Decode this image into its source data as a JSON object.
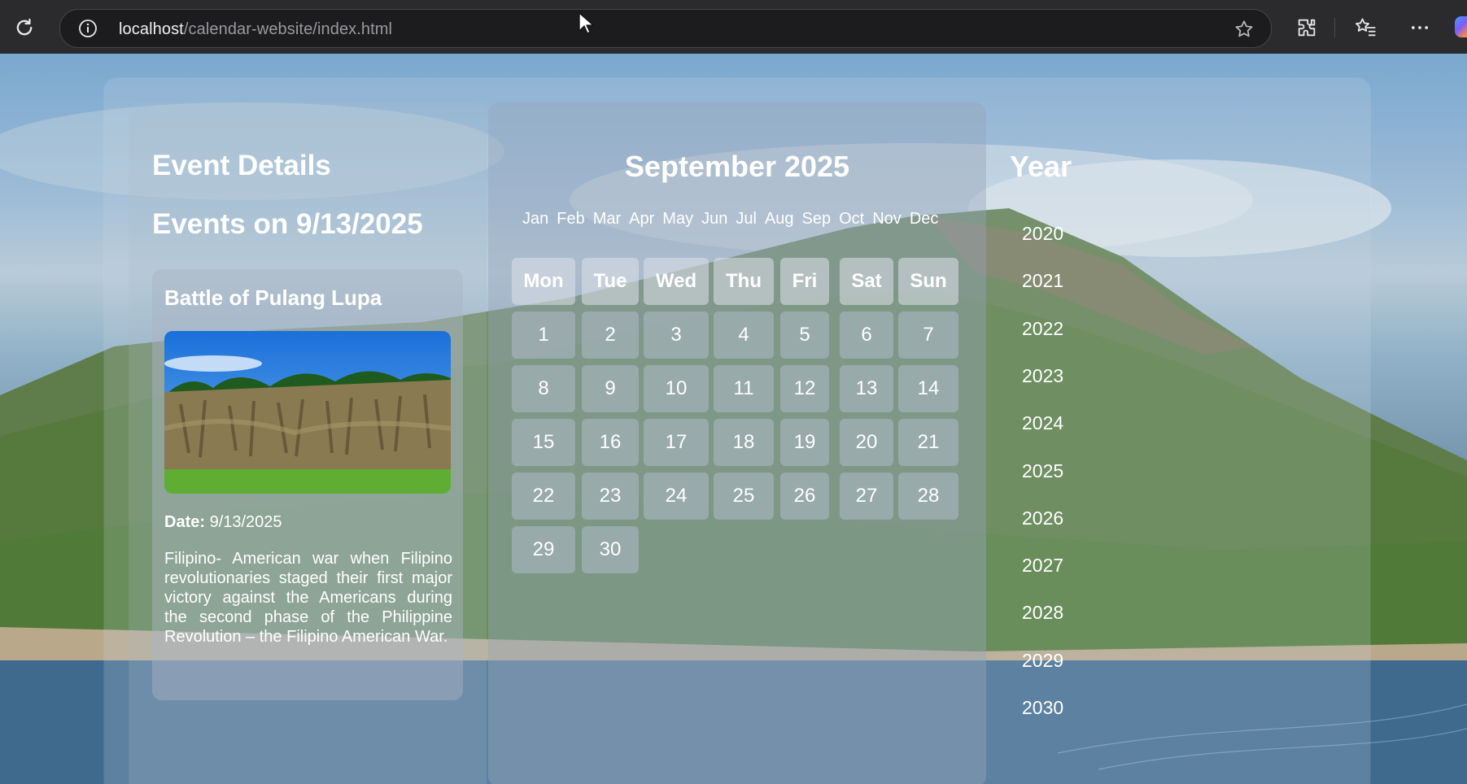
{
  "browser": {
    "url_host": "localhost",
    "url_path": "/calendar-website/index.html"
  },
  "event_panel": {
    "heading": "Event Details",
    "subheading": "Events on 9/13/2025",
    "event": {
      "title": "Battle of Pulang Lupa",
      "date_label": "Date:",
      "date_value": "9/13/2025",
      "description": "Filipino- American war when Filipino revolutionaries staged their first major victory against the Americans during the second phase of the Philippine Revolution – the Filipino American War."
    }
  },
  "calendar": {
    "title": "September 2025",
    "months": [
      "Jan",
      "Feb",
      "Mar",
      "Apr",
      "May",
      "Jun",
      "Jul",
      "Aug",
      "Sep",
      "Oct",
      "Nov",
      "Dec"
    ],
    "weekdays": [
      "Mon",
      "Tue",
      "Wed",
      "Thu",
      "Fri",
      "Sat",
      "Sun"
    ],
    "days": [
      "1",
      "2",
      "3",
      "4",
      "5",
      "6",
      "7",
      "8",
      "9",
      "10",
      "11",
      "12",
      "13",
      "14",
      "15",
      "16",
      "17",
      "18",
      "19",
      "20",
      "21",
      "22",
      "23",
      "24",
      "25",
      "26",
      "27",
      "28",
      "29",
      "30"
    ]
  },
  "years_panel": {
    "title": "Year",
    "years": [
      "2020",
      "2021",
      "2022",
      "2023",
      "2024",
      "2025",
      "2026",
      "2027",
      "2028",
      "2029",
      "2030"
    ]
  },
  "colors": {
    "chrome_bg": "#2b2b2e",
    "text": "#ffffff"
  }
}
